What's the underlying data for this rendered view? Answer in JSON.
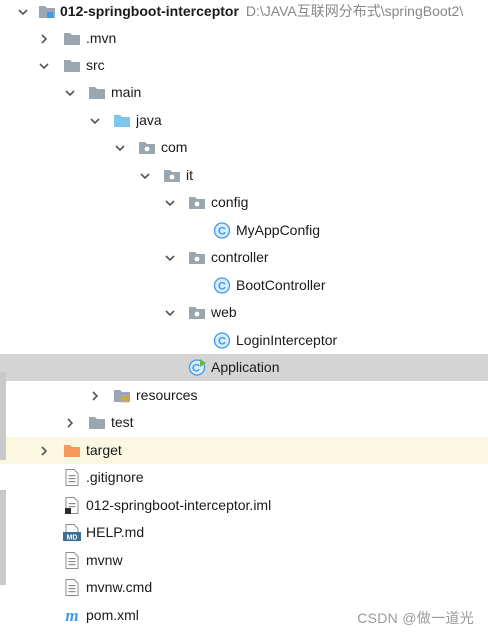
{
  "project_tree": {
    "root": {
      "label": "012-springboot-interceptor",
      "path": "D:\\JAVA互联网分布式\\springBoot2\\"
    },
    "items": [
      {
        "label": ".mvn",
        "icon": "folder-icon"
      },
      {
        "label": "src",
        "icon": "folder-icon"
      },
      {
        "label": "main",
        "icon": "folder-icon"
      },
      {
        "label": "java",
        "icon": "source-folder-icon"
      },
      {
        "label": "com",
        "icon": "package-icon"
      },
      {
        "label": "it",
        "icon": "package-icon"
      },
      {
        "label": "config",
        "icon": "package-icon"
      },
      {
        "label": "MyAppConfig",
        "icon": "java-class-icon"
      },
      {
        "label": "controller",
        "icon": "package-icon"
      },
      {
        "label": "BootController",
        "icon": "java-class-icon"
      },
      {
        "label": "web",
        "icon": "package-icon"
      },
      {
        "label": "LoginInterceptor",
        "icon": "java-class-icon"
      },
      {
        "label": "Application",
        "icon": "spring-boot-class-icon",
        "selected": true
      },
      {
        "label": "resources",
        "icon": "resources-folder-icon"
      },
      {
        "label": "test",
        "icon": "folder-icon"
      },
      {
        "label": "target",
        "icon": "excluded-folder-icon"
      },
      {
        "label": ".gitignore",
        "icon": "text-file-icon"
      },
      {
        "label": "012-springboot-interceptor.iml",
        "icon": "iml-file-icon"
      },
      {
        "label": "HELP.md",
        "icon": "markdown-file-icon"
      },
      {
        "label": "mvnw",
        "icon": "text-file-icon"
      },
      {
        "label": "mvnw.cmd",
        "icon": "text-file-icon"
      },
      {
        "label": "pom.xml",
        "icon": "maven-icon"
      }
    ]
  },
  "watermark": "CSDN @做一道光",
  "colors": {
    "selection": "#d4d4d4",
    "excluded_row": "#fbf8e1",
    "folder": "#9aa7b0",
    "source_folder": "#7fc6ec",
    "excluded_folder": "#f49a5c",
    "class_icon": "#3c9ae8",
    "spring_icon": "#6db33f",
    "path_text": "#888888"
  }
}
